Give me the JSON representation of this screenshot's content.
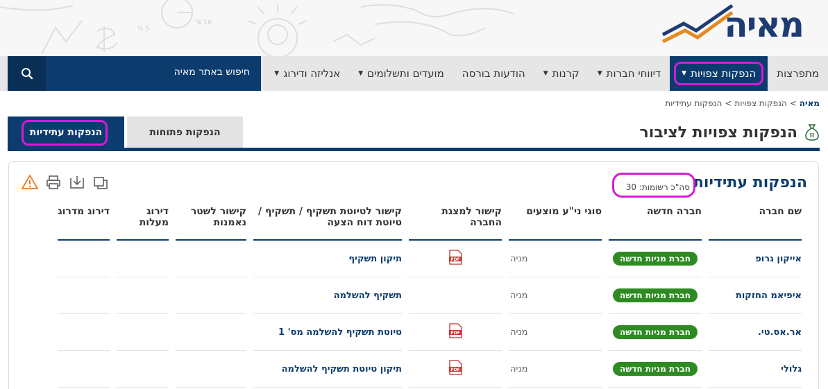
{
  "header": {
    "logo_text": "מאיה",
    "deco_text_1": "5 %",
    "deco_text_2": "10 %"
  },
  "nav": {
    "items": [
      {
        "label": "מתפרצות",
        "caret": false
      },
      {
        "label": "הנפקות צפויות",
        "caret": true,
        "active": true
      },
      {
        "label": "דיווחי חברות",
        "caret": true
      },
      {
        "label": "קרנות",
        "caret": true
      },
      {
        "label": "הודעות בורסה",
        "caret": false
      },
      {
        "label": "מועדים ותשלומים",
        "caret": true
      },
      {
        "label": "אנליזה ודירוג",
        "caret": true
      }
    ],
    "search_label": "חיפוש באתר מאיה"
  },
  "breadcrumb": {
    "home": "מאיה",
    "sep": ">",
    "level1": "הנפקות צפויות",
    "level2": "הנפקות עתידיות"
  },
  "page": {
    "title": "הנפקות צפויות לציבור",
    "tab_open": "הנפקות פתוחות",
    "tab_future": "הנפקות עתידיות"
  },
  "panel": {
    "title": "הנפקות עתידיות",
    "records": "סה\"כ רשומות: 30"
  },
  "table": {
    "headers": [
      "שם חברה",
      "חברה חדשה",
      "סוגי ני\"ע מוצעים",
      "קישור למצגת החברה",
      "קישור לטיוטת תשקיף / תשקיף / טיוטת דוח הצעה",
      "קישור לשטר נאמנות",
      "דירוג מעלות",
      "דירוג מדרוג"
    ],
    "rows": [
      {
        "name": "אייקון גרופ",
        "new": "חברת מניות חדשה",
        "type": "מניה",
        "pdf": true,
        "link": "תיקון תשקיף"
      },
      {
        "name": "איפיאמ החזקות",
        "new": "חברת מניות חדשה",
        "type": "מניה",
        "pdf": false,
        "link": "תשקיף להשלמה"
      },
      {
        "name": "אר.אס.טי.",
        "new": "חברת מניות חדשה",
        "type": "מניה",
        "pdf": true,
        "link": "טיוטת תשקיף להשלמה מס' 1"
      },
      {
        "name": "גלולי",
        "new": "חברת מניות חדשה",
        "type": "מניה",
        "pdf": true,
        "link": "תיקון טיוטת תשקיף להשלמה"
      }
    ]
  },
  "colors": {
    "primary": "#0c3c6e",
    "highlight": "#d51bd8",
    "badge": "#2e8b22"
  }
}
